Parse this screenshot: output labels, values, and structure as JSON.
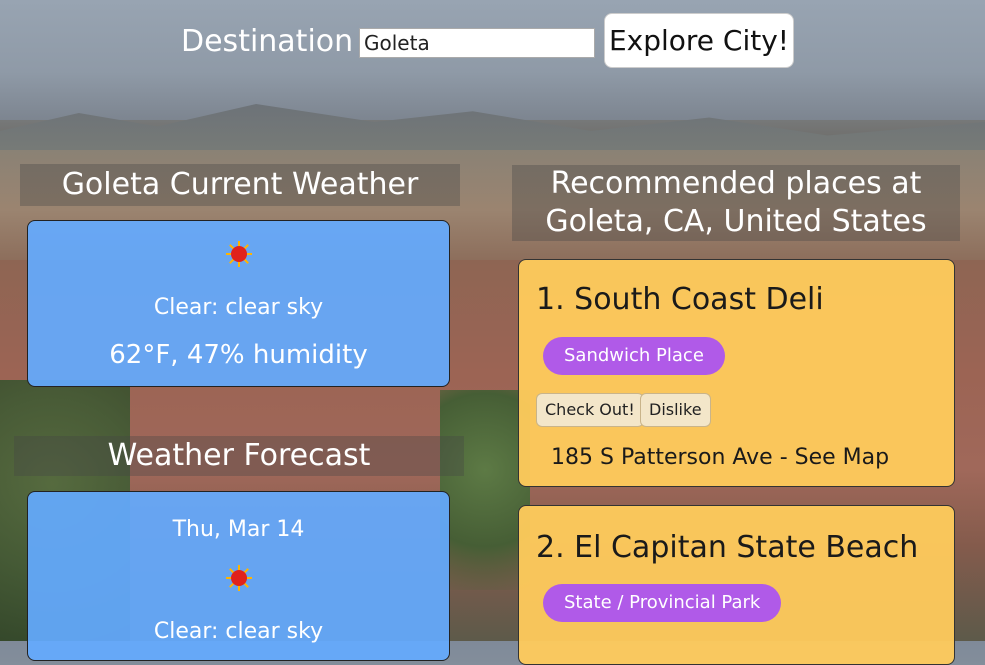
{
  "header": {
    "destination_label": "Destination",
    "destination_value": "Goleta",
    "explore_button": "Explore City!"
  },
  "weather": {
    "title": "Goleta Current Weather",
    "icon": "sun-icon",
    "condition": "Clear: clear sky",
    "temp_humidity": "62°F, 47% humidity"
  },
  "forecast": {
    "title": "Weather Forecast",
    "items": [
      {
        "date": "Thu, Mar 14",
        "icon": "sun-icon",
        "condition": "Clear: clear sky"
      }
    ]
  },
  "places": {
    "title_line1": "Recommended places at",
    "title_line2": "Goleta, CA, United States",
    "items": [
      {
        "name": "1. South Coast Deli",
        "category": "Sandwich Place",
        "checkout_label": "Check Out!",
        "dislike_label": "Dislike",
        "address": "185 S Patterson Ave - See Map"
      },
      {
        "name": "2. El Capitan State Beach",
        "category": "State / Provincial Park"
      }
    ]
  },
  "colors": {
    "weather_card": "#64aaff",
    "place_card": "#ffcb5c",
    "category_pill": "#b05ae8",
    "sun": "#e0221b"
  }
}
